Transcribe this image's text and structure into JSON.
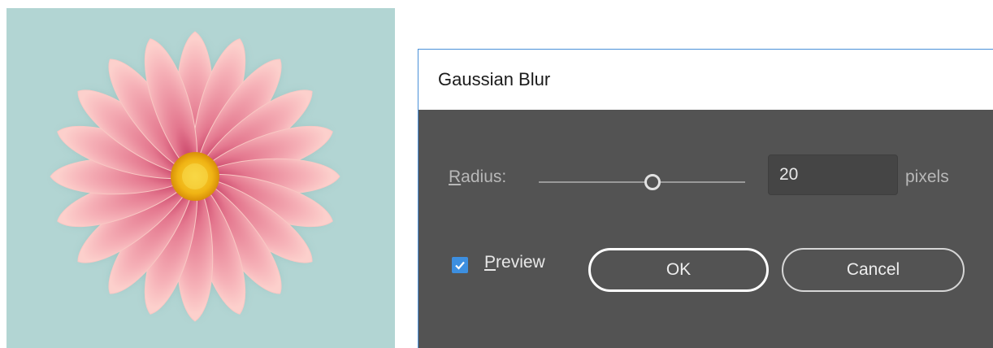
{
  "dialog": {
    "title": "Gaussian Blur",
    "radius": {
      "label": "Radius:",
      "value": "20",
      "units": "pixels"
    },
    "preview": {
      "label": "Preview",
      "checked": true
    },
    "buttons": {
      "ok": "OK",
      "cancel": "Cancel"
    }
  },
  "colors": {
    "dialog_background": "#535353",
    "checkbox_accent": "#3d8fe0",
    "canvas_background": "#b2d5d3",
    "petal": "#f0a0b0",
    "flower_center": "#f2b90f"
  },
  "icons": {
    "checkbox": "checkmark-icon"
  }
}
